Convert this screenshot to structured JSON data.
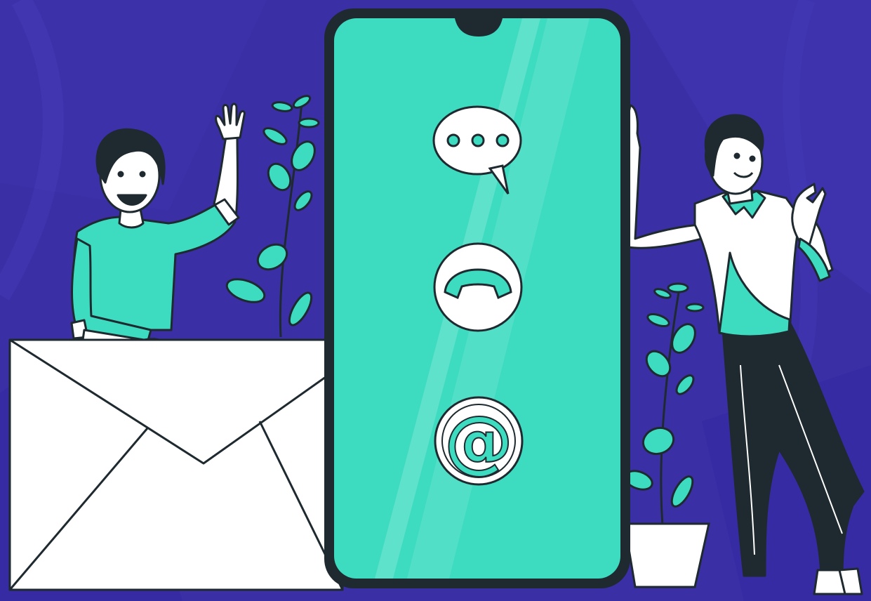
{
  "colors": {
    "background": "#3b2fa6",
    "background_dark": "#2f2590",
    "background_light": "#4a3db8",
    "accent": "#3ddbc0",
    "accent_light": "#7ae8d6",
    "ink": "#1e2a30",
    "white": "#ffffff",
    "skin": "#ffffff"
  },
  "icons": {
    "chat": "chat-bubble-icon",
    "phone": "phone-handset-icon",
    "email": "at-sign-icon"
  },
  "labels": {
    "email_symbol": "@"
  }
}
